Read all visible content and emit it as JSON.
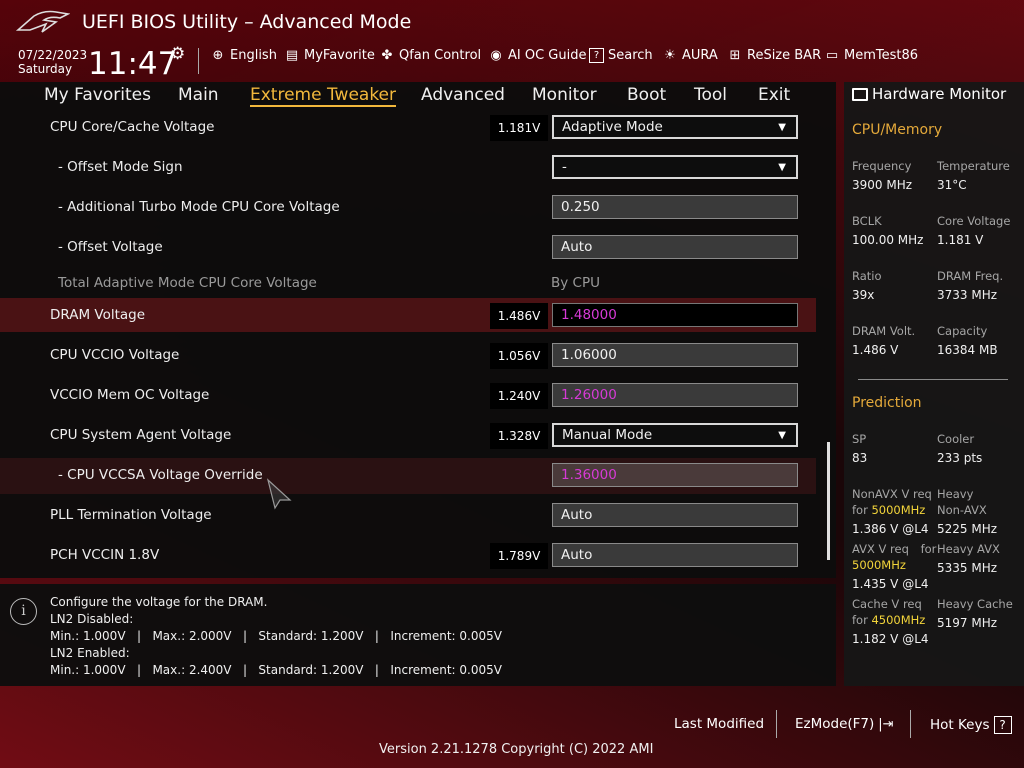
{
  "app": {
    "title": "UEFI BIOS Utility – Advanced Mode"
  },
  "clock": {
    "date": "07/22/2023",
    "weekday": "Saturday",
    "time": "11:47"
  },
  "toolbar": [
    {
      "label": "English",
      "icon": "globe-icon"
    },
    {
      "label": "MyFavorite",
      "icon": "favorite-icon"
    },
    {
      "label": "Qfan Control",
      "icon": "fan-icon"
    },
    {
      "label": "AI OC Guide",
      "icon": "ai-oc-icon"
    },
    {
      "label": "Search",
      "icon": "question-box-icon"
    },
    {
      "label": "AURA",
      "icon": "aura-icon"
    },
    {
      "label": "ReSize BAR",
      "icon": "resize-bar-icon"
    },
    {
      "label": "MemTest86",
      "icon": "memtest-icon"
    }
  ],
  "tabs": [
    "My Favorites",
    "Main",
    "Extreme Tweaker",
    "Advanced",
    "Monitor",
    "Boot",
    "Tool",
    "Exit"
  ],
  "active_tab": "Extreme Tweaker",
  "settings": [
    {
      "label": "CPU Core/Cache Voltage",
      "voltage": "1.181V",
      "value": "Adaptive Mode"
    },
    {
      "label": "- Offset Mode Sign",
      "value": "-"
    },
    {
      "label": "- Additional Turbo Mode CPU Core Voltage",
      "value": "0.250"
    },
    {
      "label": "- Offset Voltage",
      "value": "Auto"
    },
    {
      "label": "Total Adaptive Mode CPU Core Voltage",
      "value": "By CPU"
    },
    {
      "label": "DRAM Voltage",
      "voltage": "1.486V",
      "value": "1.48000"
    },
    {
      "label": "CPU VCCIO Voltage",
      "voltage": "1.056V",
      "value": "1.06000"
    },
    {
      "label": "VCCIO Mem OC Voltage",
      "voltage": "1.240V",
      "value": "1.26000"
    },
    {
      "label": "CPU System Agent Voltage",
      "voltage": "1.328V",
      "value": "Manual Mode"
    },
    {
      "label": "- CPU VCCSA Voltage Override",
      "value": "1.36000"
    },
    {
      "label": "PLL Termination Voltage",
      "value": "Auto"
    },
    {
      "label": "PCH VCCIN 1.8V",
      "voltage": "1.789V",
      "value": "Auto"
    }
  ],
  "help": {
    "lines": [
      "Configure the voltage for the DRAM.",
      "LN2 Disabled:",
      "Min.: 1.000V   |   Max.: 2.000V   |   Standard: 1.200V   |   Increment: 0.005V",
      "LN2 Enabled:",
      "Min.: 1.000V   |   Max.: 2.400V   |   Standard: 1.200V   |   Increment: 0.005V"
    ]
  },
  "hw_monitor": {
    "title": "Hardware Monitor",
    "cpu_memory_title": "CPU/Memory",
    "items": [
      {
        "label": "Frequency",
        "value": "3900 MHz"
      },
      {
        "label": "Temperature",
        "value": "31°C"
      },
      {
        "label": "BCLK",
        "value": "100.00 MHz"
      },
      {
        "label": "Core Voltage",
        "value": "1.181 V"
      },
      {
        "label": "Ratio",
        "value": "39x"
      },
      {
        "label": "DRAM Freq.",
        "value": "3733 MHz"
      },
      {
        "label": "DRAM Volt.",
        "value": "1.486 V"
      },
      {
        "label": "Capacity",
        "value": "16384 MB"
      }
    ],
    "prediction_title": "Prediction",
    "sp_label": "SP",
    "sp_value": "83",
    "cooler_label": "Cooler",
    "cooler_value": "233 pts",
    "nonavx_req_label": "NonAVX V req",
    "nonavx_for": "for",
    "nonavx_freq": "5000MHz",
    "nonavx_value": "1.386 V @L4",
    "heavy_nonavx_label1": "Heavy",
    "heavy_nonavx_label2": "Non-AVX",
    "heavy_nonavx_value": "5225 MHz",
    "avx_req_label": "AVX V req",
    "avx_for": "for",
    "avx_freq": "5000MHz",
    "avx_value": "1.435 V @L4",
    "heavy_avx_label": "Heavy AVX",
    "heavy_avx_value": "5335 MHz",
    "cache_req_label": "Cache V req",
    "cache_for": "for",
    "cache_freq": "4500MHz",
    "cache_value": "1.182 V @L4",
    "heavy_cache_label": "Heavy Cache",
    "heavy_cache_value": "5197 MHz"
  },
  "footer": {
    "last_modified": "Last Modified",
    "ezmode": "EzMode(F7)",
    "hotkeys": "Hot Keys",
    "hotkeys_icon": "?",
    "version": "Version 2.21.1278 Copyright (C) 2022 AMI"
  },
  "colors": {
    "accent": "#f2b83c",
    "highlight_row": "#4a1214",
    "magenta_value": "#d63ad6",
    "prediction_freq": "#f2d43a"
  }
}
